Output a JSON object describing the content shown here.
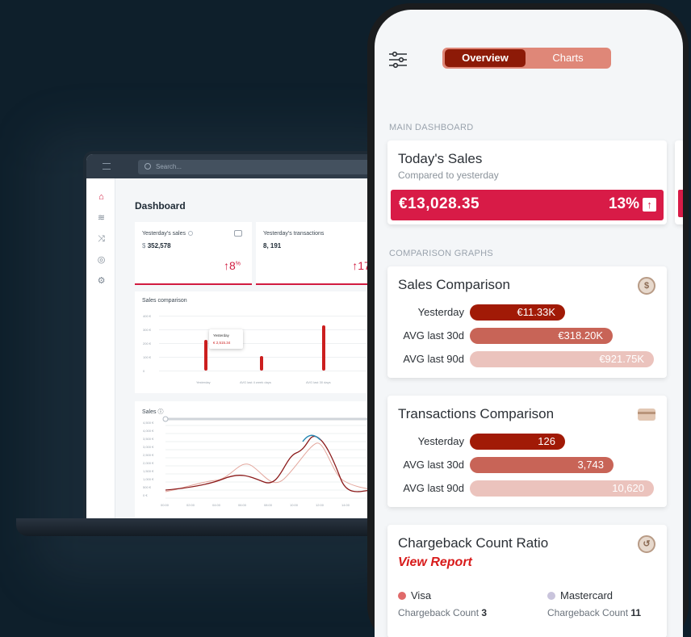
{
  "laptop": {
    "search_placeholder": "Search...",
    "title": "Dashboard",
    "kpis": [
      {
        "label": "Yesterday's sales",
        "currency": "$",
        "value": "352,578",
        "change": "8",
        "unit": "%"
      },
      {
        "label": "Yesterday's transactions",
        "value": "8, 191",
        "change": "17",
        "unit": "%"
      }
    ],
    "sales_comparison": {
      "title": "Sales comparison",
      "y_ticks": [
        "400 €",
        "300 €",
        "200 €",
        "100 €",
        "0"
      ],
      "x_labels": [
        "Yesterday",
        "AVG last 4 week days",
        "AVG last 30 days"
      ],
      "tooltip_label": "Yesterday",
      "tooltip_value": "€ 2,515.34"
    },
    "sales_chart": {
      "title": "Sales",
      "y_ticks": [
        "4,500 €",
        "4,000 €",
        "3,500 €",
        "3,000 €",
        "2,500 €",
        "2,000 €",
        "1,500 €",
        "1,000 €",
        "500 €",
        "0 €"
      ],
      "x_ticks": [
        "00:00",
        "02:00",
        "04:00",
        "06:00",
        "08:00",
        "10:00",
        "12:00",
        "14:00"
      ]
    }
  },
  "phone": {
    "tabs": {
      "active": "Overview",
      "inactive": "Charts"
    },
    "section_main": "MAIN DASHBOARD",
    "todays_sales": {
      "title": "Today's Sales",
      "subtitle": "Compared to yesterday",
      "amount": "€13,028.35",
      "change": "13%",
      "accent": "#d81b47"
    },
    "section_graphs": "COMPARISON GRAPHS",
    "sales_comparison": {
      "title": "Sales Comparison",
      "rows": [
        {
          "label": "Yesterday",
          "value": "€11.33K",
          "amount": 11.33
        },
        {
          "label": "AVG last 30d",
          "value": "€318.20K",
          "amount": 318.2
        },
        {
          "label": "AVG last 90d",
          "value": "€921.75K",
          "amount": 921.75
        }
      ]
    },
    "transactions_comparison": {
      "title": "Transactions Comparison",
      "rows": [
        {
          "label": "Yesterday",
          "value": "126",
          "amount": 126
        },
        {
          "label": "AVG last 30d",
          "value": "3,743",
          "amount": 3743
        },
        {
          "label": "AVG last 90d",
          "value": "10,620",
          "amount": 10620
        }
      ]
    },
    "chargeback": {
      "title": "Chargeback Count Ratio",
      "link": "View Report",
      "visa": {
        "name": "Visa",
        "label": "Chargeback Count",
        "value": "3",
        "color": "#e06a6a"
      },
      "mastercard": {
        "name": "Mastercard",
        "label": "Chargeback Count",
        "value": "11",
        "color": "#c9c4dc"
      }
    }
  }
}
